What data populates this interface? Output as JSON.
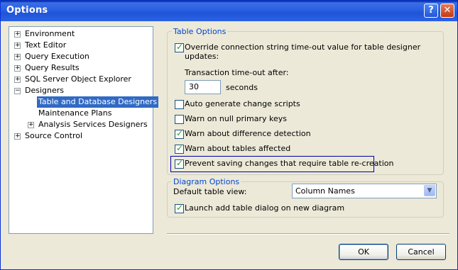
{
  "window": {
    "title": "Options",
    "help_glyph": "?",
    "close_glyph": "✕"
  },
  "tree": [
    {
      "label": "Environment",
      "expander": "+"
    },
    {
      "label": "Text Editor",
      "expander": "+"
    },
    {
      "label": "Query Execution",
      "expander": "+"
    },
    {
      "label": "Query Results",
      "expander": "+"
    },
    {
      "label": "SQL Server Object Explorer",
      "expander": "+"
    },
    {
      "label": "Designers",
      "expander": "−"
    },
    {
      "label": "Table and Database Designers",
      "expander": ""
    },
    {
      "label": "Maintenance Plans",
      "expander": ""
    },
    {
      "label": "Analysis Services Designers",
      "expander": "+"
    },
    {
      "label": "Source Control",
      "expander": "+"
    }
  ],
  "table_options": {
    "legend": "Table Options",
    "override_line1": "Override connection string time-out value for table designer",
    "override_line2": "updates:",
    "timeout_label": "Transaction time-out after:",
    "timeout_value": "30",
    "timeout_unit": "seconds",
    "auto_generate": "Auto generate change scripts",
    "warn_null": "Warn on null primary keys",
    "warn_diff": "Warn about difference detection",
    "warn_affected": "Warn about tables affected",
    "prevent_saving": "Prevent saving changes that require table re-creation",
    "checked_mark": "✓"
  },
  "diagram_options": {
    "legend": "Diagram Options",
    "default_view_label": "Default table view:",
    "default_view_value": "Column Names",
    "launch_add": "Launch add table dialog on new diagram",
    "dropdown_glyph": "▼"
  },
  "buttons": {
    "ok": "OK",
    "cancel": "Cancel"
  }
}
